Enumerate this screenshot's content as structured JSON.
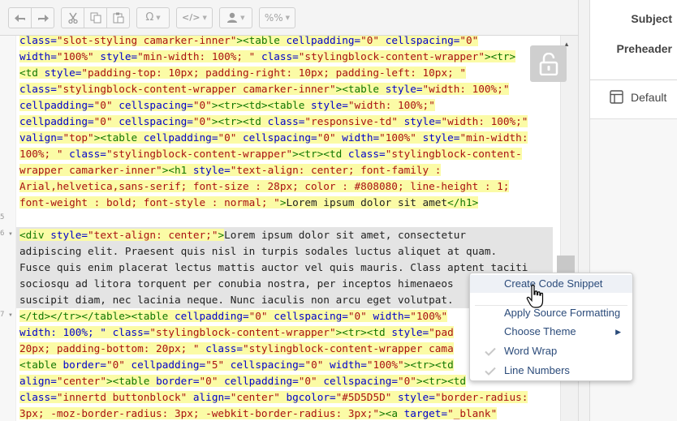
{
  "toolbar": {
    "buttons": [
      {
        "name": "undo-icon"
      },
      {
        "name": "redo-icon"
      },
      {
        "name": "cut-icon"
      },
      {
        "name": "copy-icon"
      },
      {
        "name": "paste-icon"
      },
      {
        "name": "omega-icon",
        "glyph": "Ω"
      },
      {
        "name": "code-icon",
        "glyph": "</>"
      },
      {
        "name": "user-icon"
      },
      {
        "name": "percent-icon",
        "glyph": "%%"
      }
    ]
  },
  "editor": {
    "line_numbers": [
      "5",
      "6",
      "7"
    ],
    "lines": [
      [
        {
          "c": "t-att",
          "t": "class="
        },
        {
          "c": "t-str",
          "t": "\"slot-styling camarker-inner\""
        },
        {
          "c": "t-tag",
          "t": "><table "
        },
        {
          "c": "t-att",
          "t": "cellpadding="
        },
        {
          "c": "t-str",
          "t": "\"0\" "
        },
        {
          "c": "t-att",
          "t": "cellspacing="
        },
        {
          "c": "t-str",
          "t": "\"0\""
        }
      ],
      [
        {
          "c": "t-att",
          "t": "width="
        },
        {
          "c": "t-str",
          "t": "\"100%\" "
        },
        {
          "c": "t-att",
          "t": "style="
        },
        {
          "c": "t-str",
          "t": "\"min-width: 100%; \" "
        },
        {
          "c": "t-att",
          "t": "class="
        },
        {
          "c": "t-str",
          "t": "\"stylingblock-content-wrapper\""
        },
        {
          "c": "t-tag",
          "t": "><tr>"
        }
      ],
      [
        {
          "c": "t-tag",
          "t": "<td "
        },
        {
          "c": "t-att",
          "t": "style="
        },
        {
          "c": "t-str",
          "t": "\"padding-top: 10px; padding-right: 10px; padding-left: 10px; \""
        }
      ],
      [
        {
          "c": "t-att",
          "t": "class="
        },
        {
          "c": "t-str",
          "t": "\"stylingblock-content-wrapper camarker-inner\""
        },
        {
          "c": "t-tag",
          "t": "><table "
        },
        {
          "c": "t-att",
          "t": "style="
        },
        {
          "c": "t-str",
          "t": "\"width: 100%;\""
        }
      ],
      [
        {
          "c": "t-att",
          "t": "cellpadding="
        },
        {
          "c": "t-str",
          "t": "\"0\" "
        },
        {
          "c": "t-att",
          "t": "cellspacing="
        },
        {
          "c": "t-str",
          "t": "\"0\""
        },
        {
          "c": "t-tag",
          "t": "><tr><td><table "
        },
        {
          "c": "t-att",
          "t": "style="
        },
        {
          "c": "t-str",
          "t": "\"width: 100%;\""
        }
      ],
      [
        {
          "c": "t-att",
          "t": "cellpadding="
        },
        {
          "c": "t-str",
          "t": "\"0\" "
        },
        {
          "c": "t-att",
          "t": "cellspacing="
        },
        {
          "c": "t-str",
          "t": "\"0\""
        },
        {
          "c": "t-tag",
          "t": "><tr><td "
        },
        {
          "c": "t-att",
          "t": "class="
        },
        {
          "c": "t-str",
          "t": "\"responsive-td\" "
        },
        {
          "c": "t-att",
          "t": "style="
        },
        {
          "c": "t-str",
          "t": "\"width: 100%;\""
        }
      ],
      [
        {
          "c": "t-att",
          "t": "valign="
        },
        {
          "c": "t-str",
          "t": "\"top\""
        },
        {
          "c": "t-tag",
          "t": "><table "
        },
        {
          "c": "t-att",
          "t": "cellpadding="
        },
        {
          "c": "t-str",
          "t": "\"0\" "
        },
        {
          "c": "t-att",
          "t": "cellspacing="
        },
        {
          "c": "t-str",
          "t": "\"0\" "
        },
        {
          "c": "t-att",
          "t": "width="
        },
        {
          "c": "t-str",
          "t": "\"100%\" "
        },
        {
          "c": "t-att",
          "t": "style="
        },
        {
          "c": "t-str",
          "t": "\"min-width:"
        }
      ],
      [
        {
          "c": "t-str",
          "t": "100%; \" "
        },
        {
          "c": "t-att",
          "t": "class="
        },
        {
          "c": "t-str",
          "t": "\"stylingblock-content-wrapper\""
        },
        {
          "c": "t-tag",
          "t": "><tr><td "
        },
        {
          "c": "t-att",
          "t": "class="
        },
        {
          "c": "t-str",
          "t": "\"stylingblock-content-"
        }
      ],
      [
        {
          "c": "t-str",
          "t": "wrapper camarker-inner\""
        },
        {
          "c": "t-tag",
          "t": "><h1 "
        },
        {
          "c": "t-att",
          "t": "style="
        },
        {
          "c": "t-str",
          "t": "\"text-align: center; font-family :"
        }
      ],
      [
        {
          "c": "t-str",
          "t": "Arial,helvetica,sans-serif; font-size : 28px; color : #808080; line-height : 1;"
        }
      ],
      [
        {
          "c": "t-str",
          "t": "font-weight : bold; font-style : normal; \""
        },
        {
          "c": "t-tag",
          "t": ">"
        },
        {
          "c": "t-txt",
          "t": "Lorem ipsum dolor sit amet"
        },
        {
          "c": "t-tag",
          "t": "</h1>"
        }
      ],
      [],
      [
        {
          "c": "t-tag",
          "t": "<div "
        },
        {
          "c": "t-att",
          "t": "style="
        },
        {
          "c": "t-str",
          "t": "\"text-align: center;\""
        },
        {
          "c": "t-tag",
          "t": ">"
        },
        {
          "c": "t-txt",
          "t": "Lorem ipsum dolor sit amet, consectetur"
        }
      ],
      [
        {
          "c": "t-txt",
          "t": "adipiscing elit. Praesent quis nisl in turpis sodales luctus aliquet at quam."
        }
      ],
      [
        {
          "c": "t-txt",
          "t": "Fusce quis enim placerat lectus mattis auctor vel quis mauris. Class aptent taciti"
        }
      ],
      [
        {
          "c": "t-txt",
          "t": "sociosqu ad litora torquent per conubia nostra, per inceptos himenaeos"
        }
      ],
      [
        {
          "c": "t-txt",
          "t": "suscipit diam, nec lacinia neque. Nunc iaculis non arcu eget volutpat."
        }
      ],
      [
        {
          "c": "t-tag",
          "t": "</td></tr></table><table "
        },
        {
          "c": "t-att",
          "t": "cellpadding="
        },
        {
          "c": "t-str",
          "t": "\"0\" "
        },
        {
          "c": "t-att",
          "t": "cellspacing="
        },
        {
          "c": "t-str",
          "t": "\"0\" "
        },
        {
          "c": "t-att",
          "t": "width="
        },
        {
          "c": "t-str",
          "t": "\"100%\""
        }
      ],
      [
        {
          "c": "t-att",
          "t": "width: 100%; \" "
        },
        {
          "c": "t-att",
          "t": "class="
        },
        {
          "c": "t-str",
          "t": "\"stylingblock-content-wrapper\""
        },
        {
          "c": "t-tag",
          "t": "><tr><td "
        },
        {
          "c": "t-att",
          "t": "style="
        },
        {
          "c": "t-str",
          "t": "\"pad"
        }
      ],
      [
        {
          "c": "t-str",
          "t": "20px; padding-bottom: 20px; \" "
        },
        {
          "c": "t-att",
          "t": "class="
        },
        {
          "c": "t-str",
          "t": "\"stylingblock-content-wrapper cama"
        }
      ],
      [
        {
          "c": "t-tag",
          "t": "<table "
        },
        {
          "c": "t-att",
          "t": "border="
        },
        {
          "c": "t-str",
          "t": "\"0\" "
        },
        {
          "c": "t-att",
          "t": "cellpadding="
        },
        {
          "c": "t-str",
          "t": "\"5\" "
        },
        {
          "c": "t-att",
          "t": "cellspacing="
        },
        {
          "c": "t-str",
          "t": "\"0\" "
        },
        {
          "c": "t-att",
          "t": "width="
        },
        {
          "c": "t-str",
          "t": "\"100%\""
        },
        {
          "c": "t-tag",
          "t": "><tr><td"
        }
      ],
      [
        {
          "c": "t-att",
          "t": "align="
        },
        {
          "c": "t-str",
          "t": "\"center\""
        },
        {
          "c": "t-tag",
          "t": "><table "
        },
        {
          "c": "t-att",
          "t": "border="
        },
        {
          "c": "t-str",
          "t": "\"0\" "
        },
        {
          "c": "t-att",
          "t": "cellpadding="
        },
        {
          "c": "t-str",
          "t": "\"0\" "
        },
        {
          "c": "t-att",
          "t": "cellspacing="
        },
        {
          "c": "t-str",
          "t": "\"0\""
        },
        {
          "c": "t-tag",
          "t": "><tr><td"
        }
      ],
      [
        {
          "c": "t-att",
          "t": "class="
        },
        {
          "c": "t-str",
          "t": "\"innertd buttonblock\" "
        },
        {
          "c": "t-att",
          "t": "align="
        },
        {
          "c": "t-str",
          "t": "\"center\" "
        },
        {
          "c": "t-att",
          "t": "bgcolor="
        },
        {
          "c": "t-str",
          "t": "\"#5D5D5D\" "
        },
        {
          "c": "t-att",
          "t": "style="
        },
        {
          "c": "t-str",
          "t": "\"border-radius:"
        }
      ],
      [
        {
          "c": "t-str",
          "t": "3px; -moz-border-radius: 3px; -webkit-border-radius: 3px;\""
        },
        {
          "c": "t-tag",
          "t": "><a "
        },
        {
          "c": "t-att",
          "t": "target="
        },
        {
          "c": "t-str",
          "t": "\"_blank\""
        }
      ]
    ]
  },
  "side_panel": {
    "subject_label": "Subject",
    "preheader_label": "Preheader",
    "default_label": "Default"
  },
  "context_menu": {
    "items": [
      {
        "label": "Create Code Snippet",
        "checked": false,
        "submenu": false
      },
      {
        "label": "Apply Source Formatting",
        "checked": false,
        "submenu": false
      },
      {
        "label": "Choose Theme",
        "checked": false,
        "submenu": true
      },
      {
        "label": "Word Wrap",
        "checked": true,
        "submenu": false
      },
      {
        "label": "Line Numbers",
        "checked": true,
        "submenu": false
      }
    ]
  },
  "colors": {
    "highlight": "#fbfba6",
    "selection": "#e4e4e4",
    "menu_text": "#2b4b7a",
    "tag": "#117700",
    "attribute": "#0000cc",
    "string": "#aa1111"
  }
}
